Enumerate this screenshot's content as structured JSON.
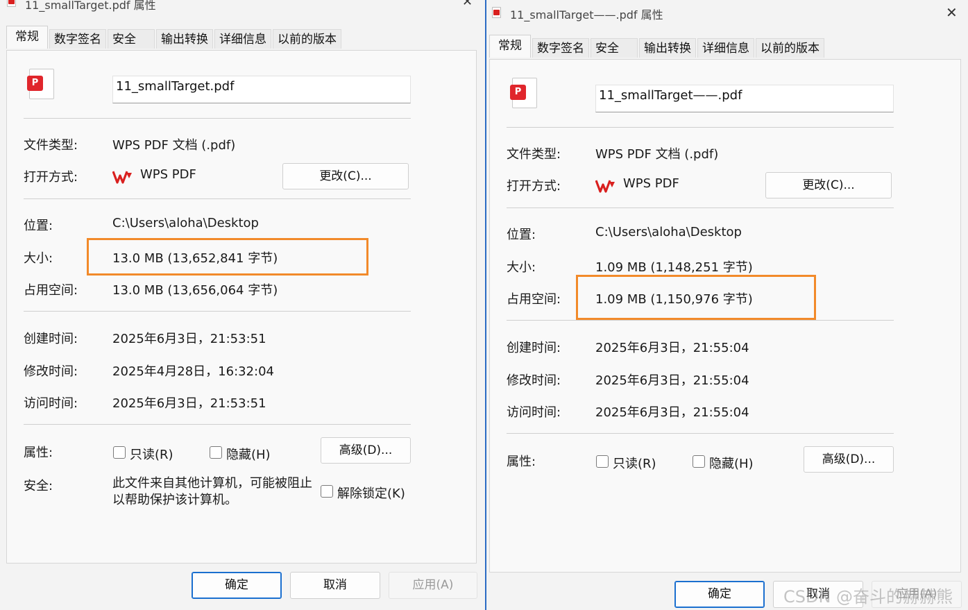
{
  "left": {
    "title": "11_smallTarget.pdf 属性",
    "close": "✕",
    "tabs": [
      "常规",
      "数字签名",
      "安全",
      "输出转换",
      "详细信息",
      "以前的版本"
    ],
    "icon_badge": "P",
    "filename": "11_smallTarget.pdf",
    "labels": {
      "type": "文件类型:",
      "open": "打开方式:",
      "location": "位置:",
      "size": "大小:",
      "disk": "占用空间:",
      "created": "创建时间:",
      "modified": "修改时间:",
      "accessed": "访问时间:",
      "attrs": "属性:",
      "security": "安全:"
    },
    "file_type": "WPS PDF 文档 (.pdf)",
    "open_with": "WPS PDF",
    "change_btn": "更改(C)...",
    "location": "C:\\Users\\aloha\\Desktop",
    "size": "13.0 MB (13,652,841 字节)",
    "disk": "13.0 MB (13,656,064 字节)",
    "created": "2025年6月3日，21:53:51",
    "modified": "2025年4月28日，16:32:04",
    "accessed": "2025年6月3日，21:53:51",
    "readonly": "只读(R)",
    "hidden": "隐藏(H)",
    "advanced_btn": "高级(D)...",
    "security_line1": "此文件来自其他计算机，可能被阻止",
    "security_line2": "以帮助保护该计算机。",
    "unblock": "解除锁定(K)",
    "ok": "确定",
    "cancel": "取消",
    "apply": "应用(A)"
  },
  "right": {
    "title": "11_smallTarget——.pdf 属性",
    "close": "✕",
    "tabs": [
      "常规",
      "数字签名",
      "安全",
      "输出转换",
      "详细信息",
      "以前的版本"
    ],
    "icon_badge": "P",
    "filename": "11_smallTarget——.pdf",
    "labels": {
      "type": "文件类型:",
      "open": "打开方式:",
      "location": "位置:",
      "size": "大小:",
      "disk": "占用空间:",
      "created": "创建时间:",
      "modified": "修改时间:",
      "accessed": "访问时间:",
      "attrs": "属性:"
    },
    "file_type": "WPS PDF 文档 (.pdf)",
    "open_with": "WPS PDF",
    "change_btn": "更改(C)...",
    "location": "C:\\Users\\aloha\\Desktop",
    "size": "1.09 MB (1,148,251 字节)",
    "disk": "1.09 MB (1,150,976 字节)",
    "created": "2025年6月3日，21:55:04",
    "modified": "2025年6月3日，21:55:04",
    "accessed": "2025年6月3日，21:55:04",
    "readonly": "只读(R)",
    "hidden": "隐藏(H)",
    "advanced_btn": "高级(D)...",
    "ok": "确定",
    "cancel": "取消",
    "apply": "应用(A)"
  },
  "watermark": "CSDN @奋斗的赫赫熊",
  "colors": {
    "highlight": "#f28a2a",
    "wps_red": "#d9201f",
    "focus_blue": "#1a6fcf"
  }
}
